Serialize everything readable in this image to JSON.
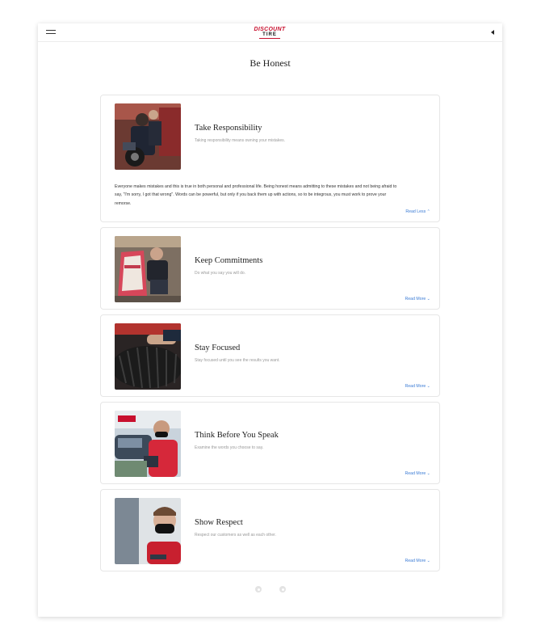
{
  "header": {
    "logo_line1": "DISCOUNT",
    "logo_line2": "TIRE",
    "menu_icon": "hamburger-icon",
    "audio_icon": "speaker-icon",
    "brand_color": "#c8102e"
  },
  "page": {
    "title": "Be Honest"
  },
  "cards": [
    {
      "title": "Take Responsibility",
      "subtitle": "Taking responsibility means owning your mistakes.",
      "body": "Everyone makes mistakes and this is true in both personal and professional life. Being honest means admitting to these mistakes and not being afraid to say, \"I'm sorry, I got that wrong\". Words can be powerful, but only if you back them up with actions, so to be integrous, you must work to prove your remorse.",
      "toggle": "Read Less ⌃",
      "expanded": true
    },
    {
      "title": "Keep Commitments",
      "subtitle": "Do what you say you will do.",
      "toggle": "Read More ⌄",
      "expanded": false
    },
    {
      "title": "Stay Focused",
      "subtitle": "Stay focused until you see the results you want.",
      "toggle": "Read More ⌄",
      "expanded": false
    },
    {
      "title": "Think Before You Speak",
      "subtitle": "Examine the words you choose to say.",
      "toggle": "Read More ⌄",
      "expanded": false
    },
    {
      "title": "Show Respect",
      "subtitle": "Respect our customers as well as each other.",
      "toggle": "Read More ⌄",
      "expanded": false
    }
  ],
  "pagination": {
    "prev_icon": "prev-dot-icon",
    "next_icon": "next-dot-icon"
  },
  "colors": {
    "link": "#3a7bd5",
    "border": "#e6e6e6"
  }
}
